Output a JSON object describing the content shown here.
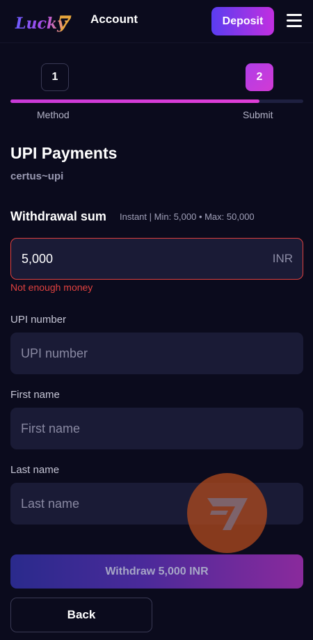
{
  "header": {
    "logo_text": "Lucky 7",
    "title": "Account",
    "deposit_label": "Deposit"
  },
  "stepper": {
    "step1_number": "1",
    "step2_number": "2",
    "step1_label": "Method",
    "step2_label": "Submit",
    "progress": 0.85
  },
  "payment": {
    "title": "UPI Payments",
    "subtitle": "certus~upi"
  },
  "withdrawal": {
    "title": "Withdrawal sum",
    "hint": "Instant | Min: 5,000 • Max: 50,000",
    "amount": "5,000",
    "currency": "INR",
    "error": "Not enough money"
  },
  "fields": {
    "upi_label": "UPI number",
    "upi_placeholder": "UPI number",
    "first_name_label": "First name",
    "first_name_placeholder": "First name",
    "last_name_label": "Last name",
    "last_name_placeholder": "Last name"
  },
  "actions": {
    "withdraw_label": "Withdraw 5,000 INR",
    "back_label": "Back"
  },
  "colors": {
    "background": "#0b0b1d",
    "accent": "#c93ad8",
    "error": "#e0413f",
    "input_bg": "#1a1b36"
  }
}
